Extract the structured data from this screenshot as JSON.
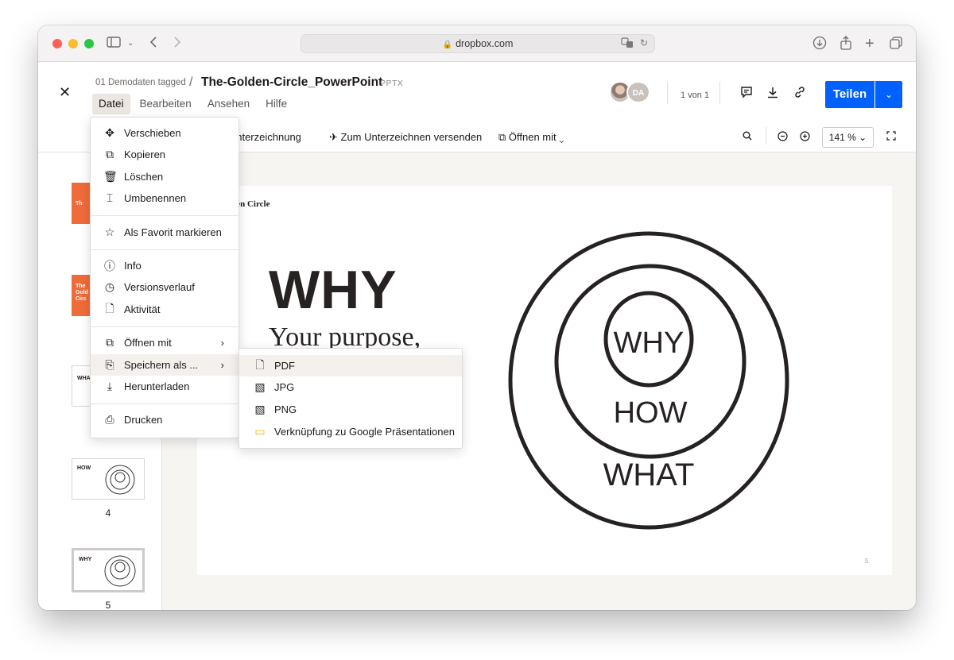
{
  "browser": {
    "url": "dropbox.com"
  },
  "header": {
    "close_icon": "close-icon",
    "folder": "01 Demodaten tagged",
    "separator": "/",
    "file_name": "The-Golden-Circle_PowerPoint",
    "file_type": "PPTX",
    "menu": [
      "Datei",
      "Bearbeiten",
      "Ansehen",
      "Hilfe"
    ],
    "avatar_initials": "DA",
    "page_count": "1 von 1",
    "share_label": "Teilen"
  },
  "toolbar": {
    "signature": "unterzeichnung",
    "send_to_sign": "Zum Unterzeichnen versenden",
    "open_with": "Öffnen mit",
    "zoom": "141 %"
  },
  "file_menu": {
    "items": [
      {
        "label": "Verschieben",
        "icon": "move-icon"
      },
      {
        "label": "Kopieren",
        "icon": "copy-icon"
      },
      {
        "label": "Löschen",
        "icon": "trash-icon"
      },
      {
        "label": "Umbenennen",
        "icon": "rename-icon"
      },
      {
        "label": "Als Favorit markieren",
        "icon": "star-icon"
      },
      {
        "label": "Info",
        "icon": "info-icon"
      },
      {
        "label": "Versionsverlauf",
        "icon": "history-icon"
      },
      {
        "label": "Aktivität",
        "icon": "activity-icon"
      },
      {
        "label": "Öffnen mit",
        "icon": "open-external-icon"
      },
      {
        "label": "Speichern als ...",
        "icon": "save-as-icon"
      },
      {
        "label": "Herunterladen",
        "icon": "download-icon"
      },
      {
        "label": "Drucken",
        "icon": "print-icon"
      }
    ]
  },
  "save_menu": {
    "items": [
      {
        "label": "PDF",
        "icon": "file-icon"
      },
      {
        "label": "JPG",
        "icon": "image-icon"
      },
      {
        "label": "PNG",
        "icon": "image-icon"
      },
      {
        "label": "Verknüpfung zu Google Präsentationen",
        "icon": "google-slides-icon"
      }
    ]
  },
  "thumbnails": {
    "t1": "Th",
    "t2": "The Gold Circ",
    "t3": "WHA",
    "t4": "HOW",
    "t5": "WHY",
    "num4": "4",
    "num5": "5"
  },
  "slide": {
    "small_title": "Golden Circle",
    "heading": "WHY",
    "subheading": "Your purpose,",
    "circle_inner": "WHY",
    "circle_middle": "HOW",
    "circle_outer": "WHAT",
    "page_number": "5"
  }
}
